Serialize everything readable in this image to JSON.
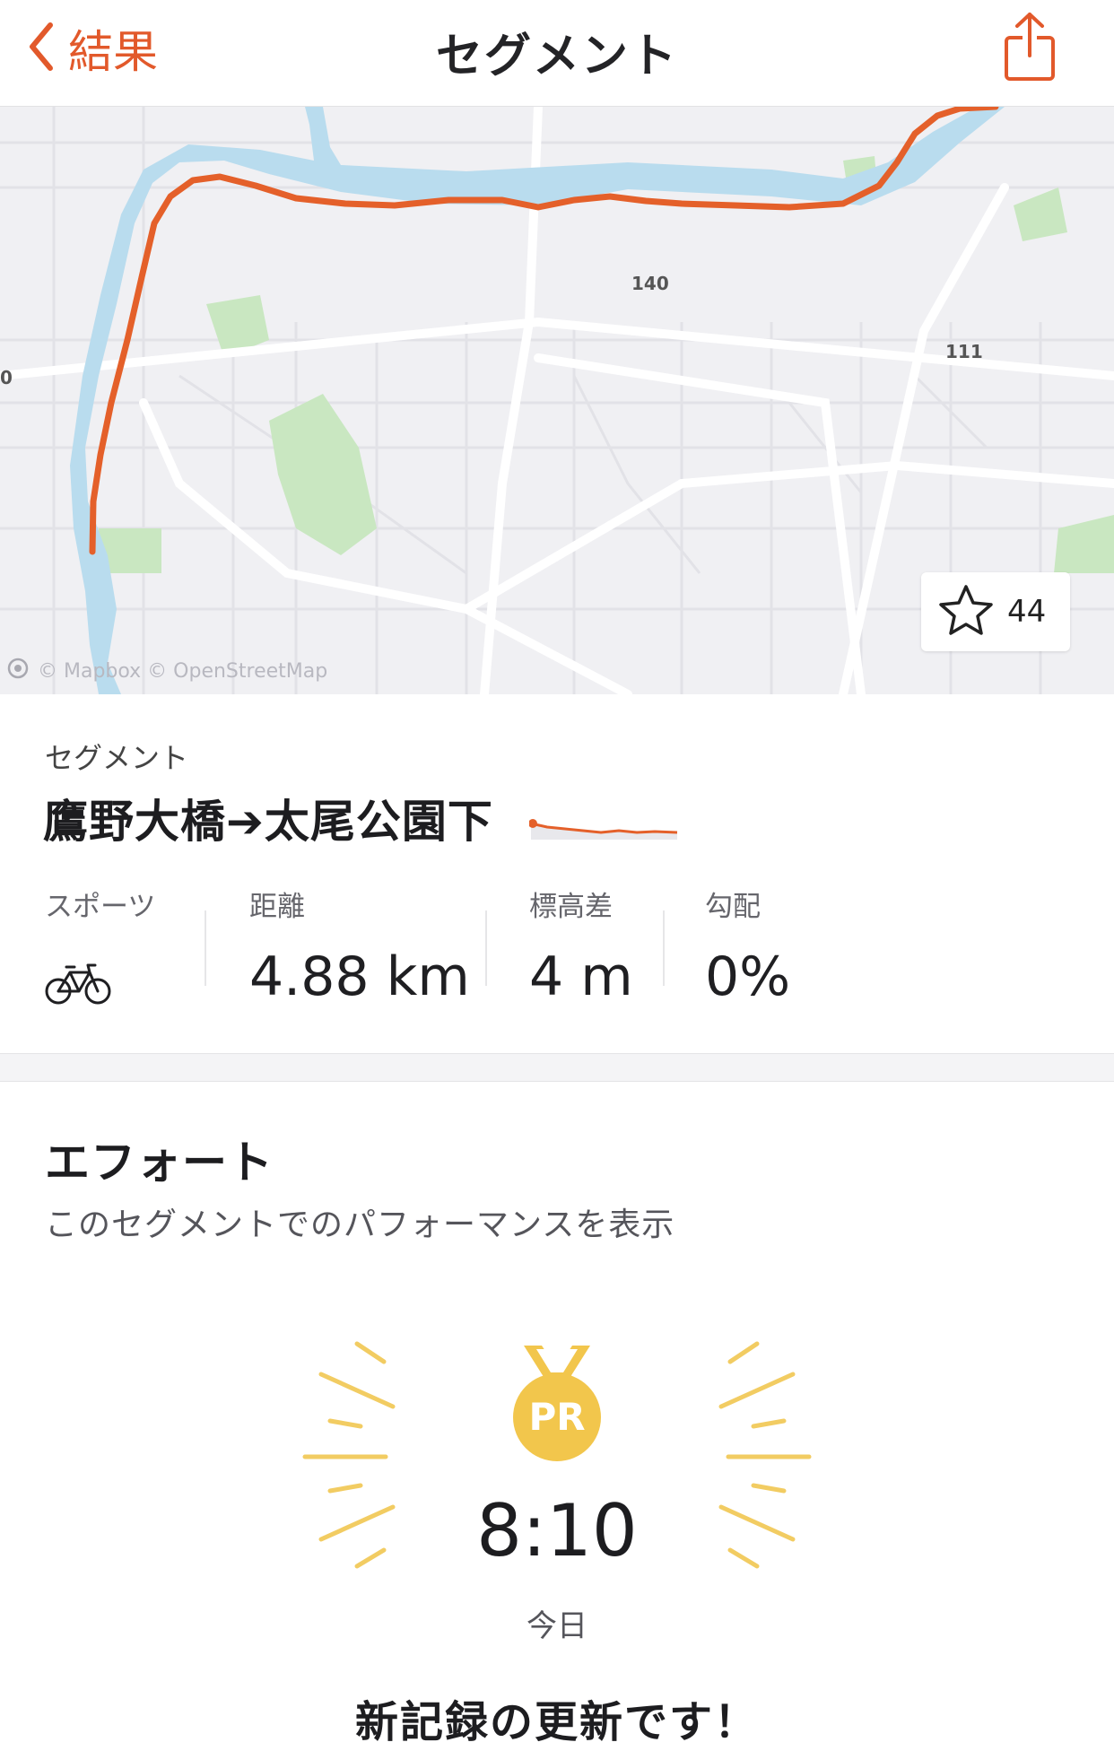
{
  "nav": {
    "back_label": "結果",
    "title": "セグメント"
  },
  "map": {
    "road_labels": [
      "140",
      "111",
      "0"
    ],
    "attribution": "© Mapbox © OpenStreetMap",
    "star_count": "44",
    "route_color": "#e4602a"
  },
  "segment": {
    "kicker": "セグメント",
    "name": "鷹野大橋➔太尾公園下",
    "stats": [
      {
        "label": "スポーツ",
        "value": "",
        "icon": "bicycle-icon"
      },
      {
        "label": "距離",
        "value": "4.88 km"
      },
      {
        "label": "標高差",
        "value": "4 m"
      },
      {
        "label": "勾配",
        "value": "0%"
      }
    ]
  },
  "efforts": {
    "title": "エフォート",
    "subtitle": "このセグメントでのパフォーマンスを表示",
    "pr_badge": "PR",
    "pr_time": "8:10",
    "pr_date": "今日",
    "pr_message": "新記録の更新です！",
    "medal_color": "#f2c64c"
  },
  "colors": {
    "accent": "#e2592b",
    "river": "#b9dcee",
    "park": "#c9e7c1"
  }
}
